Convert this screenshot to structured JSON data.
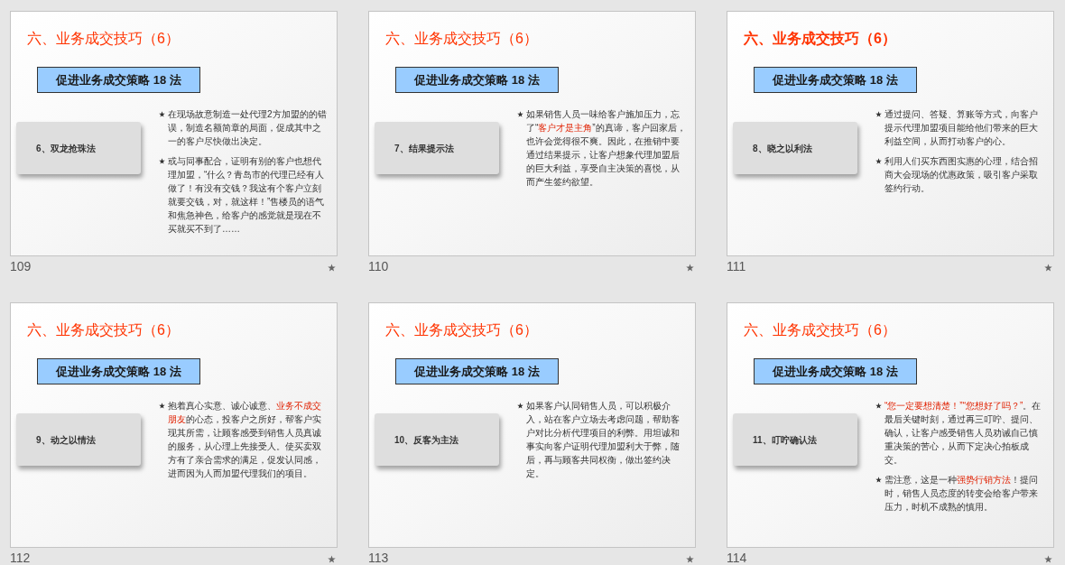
{
  "slides": [
    {
      "number": "109",
      "title": "六、业务成交技巧（6）",
      "title_bold": false,
      "heading": "促进业务成交策略 18 法",
      "method": "6、双龙抢珠法",
      "bullets": [
        [
          {
            "text": "在现场故意制造一处代理2方加盟的的错误，制造名额简章的局面，促成其中之一的客户尽快做出决定。",
            "highlight": false
          }
        ],
        [
          {
            "text": "或与同事配合，证明有别的客户也想代理加盟，“什么？青岛市的代理已经有人做了！有没有交钱？我这有个客户立刻就要交钱，对，就这样！”售楼员的语气和焦急神色，给客户的感觉就是现在不买就买不到了……",
            "highlight": false
          }
        ]
      ]
    },
    {
      "number": "110",
      "title": "六、业务成交技巧（6）",
      "title_bold": false,
      "heading": "促进业务成交策略 18 法",
      "method": "7、结果提示法",
      "bullets": [
        [
          {
            "text": "如果销售人员一味给客户施加压力，忘了“",
            "highlight": false
          },
          {
            "text": "客户才是主角",
            "highlight": true
          },
          {
            "text": "”的真谛，客户回家后，也许会觉得很不爽。因此，在推销中要通过结果提示，让客户想象代理加盟后的巨大利益，享受自主决策的喜悦，从而产生签约欲望。",
            "highlight": false
          }
        ]
      ]
    },
    {
      "number": "111",
      "title": "六、业务成交技巧（6）",
      "title_bold": true,
      "heading": "促进业务成交策略 18 法",
      "method": "8、晓之以利法",
      "bullets": [
        [
          {
            "text": "通过提问、答疑、算账等方式，向客户提示代理加盟项目能给他们带来的巨大利益空间，从而打动客户的心。",
            "highlight": false
          }
        ],
        [
          {
            "text": "利用人们买东西图实惠的心理，结合招商大会现场的优惠政策，吸引客户采取签约行动。",
            "highlight": false
          }
        ]
      ]
    },
    {
      "number": "112",
      "title": "六、业务成交技巧（6）",
      "title_bold": false,
      "heading": "促进业务成交策略 18 法",
      "method": "9、动之以情法",
      "bullets": [
        [
          {
            "text": "抱着真心实意、诚心诚意、",
            "highlight": false
          },
          {
            "text": "业务不成交朋友",
            "highlight": true
          },
          {
            "text": "的心态，投客户之所好，帮客户实现其所需，让顾客感受到销售人员真诚的服务，从心理上先接受人。使买卖双方有了亲合需求的满足，促发认同感，进而因为人而加盟代理我们的项目。",
            "highlight": false
          }
        ]
      ]
    },
    {
      "number": "113",
      "title": "六、业务成交技巧（6）",
      "title_bold": false,
      "heading": "促进业务成交策略 18 法",
      "method": "10、反客为主法",
      "bullets": [
        [
          {
            "text": "如果客户认同销售人员，可以积极介入，站在客户立场去考虑问题，帮助客户对比分析代理项目的利弊。用坦诚和事实向客户证明代理加盟利大于弊，随后，再与顾客共同权衡，做出签约决定。",
            "highlight": false
          }
        ]
      ]
    },
    {
      "number": "114",
      "title": "六、业务成交技巧（6）",
      "title_bold": false,
      "heading": "促进业务成交策略 18 法",
      "method": "11、叮咛确认法",
      "bullets": [
        [
          {
            "text": "“您一定要想清楚！”“您想好了吗？”",
            "highlight": true
          },
          {
            "text": "。在最后关键时刻，通过再三叮咛、提问、确认，让客户感受销售人员劝诫自己慎重决策的苦心，从而下定决心拍板成交。",
            "highlight": false
          }
        ],
        [
          {
            "text": "需注意，这是一种",
            "highlight": false
          },
          {
            "text": "强势行销方法",
            "highlight": true
          },
          {
            "text": "！提问时，销售人员态度的转变会给客户带来压力，时机不成熟的慎用。",
            "highlight": false
          }
        ]
      ]
    }
  ]
}
